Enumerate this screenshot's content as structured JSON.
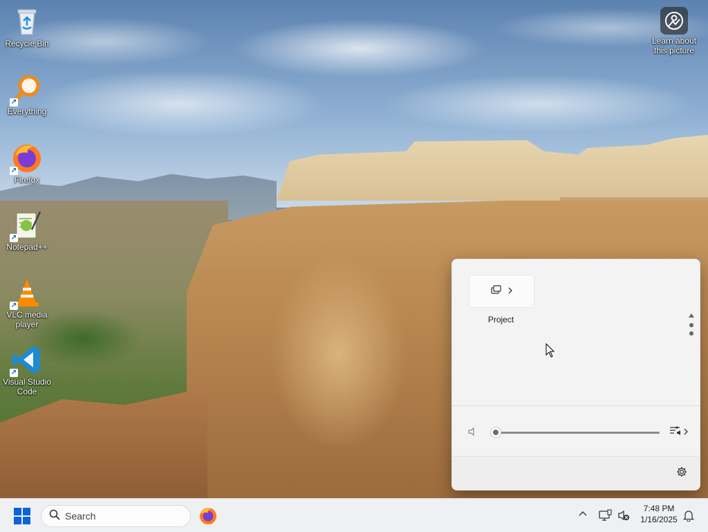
{
  "desktop": {
    "icons": [
      {
        "label": "Recycle Bin"
      },
      {
        "label": "Everything"
      },
      {
        "label": "Firefox"
      },
      {
        "label": "Notepad++"
      },
      {
        "label": "VLC media player"
      },
      {
        "label": "Visual Studio Code"
      }
    ],
    "learn_picture": {
      "label": "Learn about this picture"
    }
  },
  "quick_settings": {
    "tiles": [
      {
        "label": "Project",
        "icon": "project-icon"
      }
    ],
    "volume": {
      "level_percent": 0
    },
    "settings_icon": "gear-icon"
  },
  "taskbar": {
    "search": {
      "placeholder": "Search"
    },
    "pinned_apps": [
      "Firefox"
    ],
    "clock": {
      "time": "7:48 PM",
      "date": "1/16/2025"
    }
  },
  "colors": {
    "accent": "#005fb8",
    "start_blue": "#0a64d8",
    "panel_bg": "#f3f3f3",
    "taskbar_bg": "#eef0f3"
  }
}
